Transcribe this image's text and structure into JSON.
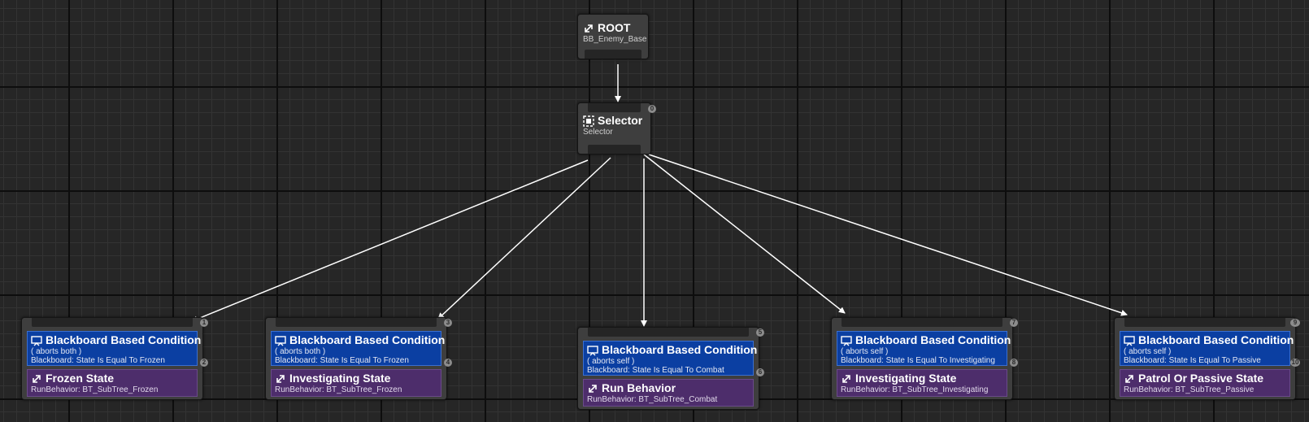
{
  "root": {
    "title": "ROOT",
    "subtitle": "BB_Enemy_Base",
    "icon": "subtree-arrow-icon"
  },
  "selector": {
    "title": "Selector",
    "subtitle": "Selector",
    "index": "0",
    "icon": "selector-icon"
  },
  "children": [
    {
      "decorator": {
        "title": "Blackboard Based Condition",
        "aborts": "( aborts both )",
        "condition": "Blackboard: State Is Equal To Frozen",
        "index": "2"
      },
      "task": {
        "title": "Frozen State",
        "detail": "RunBehavior: BT_SubTree_Frozen"
      },
      "index": "1"
    },
    {
      "decorator": {
        "title": "Blackboard Based Condition",
        "aborts": "( aborts both )",
        "condition": "Blackboard: State Is Equal To Frozen",
        "index": "4"
      },
      "task": {
        "title": "Investigating State",
        "detail": "RunBehavior: BT_SubTree_Frozen"
      },
      "index": "3"
    },
    {
      "decorator": {
        "title": "Blackboard Based Condition",
        "aborts": "( aborts self )",
        "condition": "Blackboard: State Is Equal To Combat",
        "index": "6"
      },
      "task": {
        "title": "Run Behavior",
        "detail": "RunBehavior: BT_SubTree_Combat"
      },
      "index": "5"
    },
    {
      "decorator": {
        "title": "Blackboard Based Condition",
        "aborts": "( aborts self )",
        "condition": "Blackboard: State Is Equal To Investigating",
        "index": "8"
      },
      "task": {
        "title": "Investigating State",
        "detail": "RunBehavior: BT_SubTree_Investigating"
      },
      "index": "7"
    },
    {
      "decorator": {
        "title": "Blackboard Based Condition",
        "aborts": "( aborts self )",
        "condition": "Blackboard: State Is Equal To Passive",
        "index": "10"
      },
      "task": {
        "title": "Patrol Or Passive State",
        "detail": "RunBehavior: BT_SubTree_Passive"
      },
      "index": "9"
    }
  ],
  "colors": {
    "decorator": "#0b3fa2",
    "task": "#4d2d6b",
    "node": "#3e3e3e",
    "wire": "#ffffff",
    "grid_background": "#262626"
  }
}
